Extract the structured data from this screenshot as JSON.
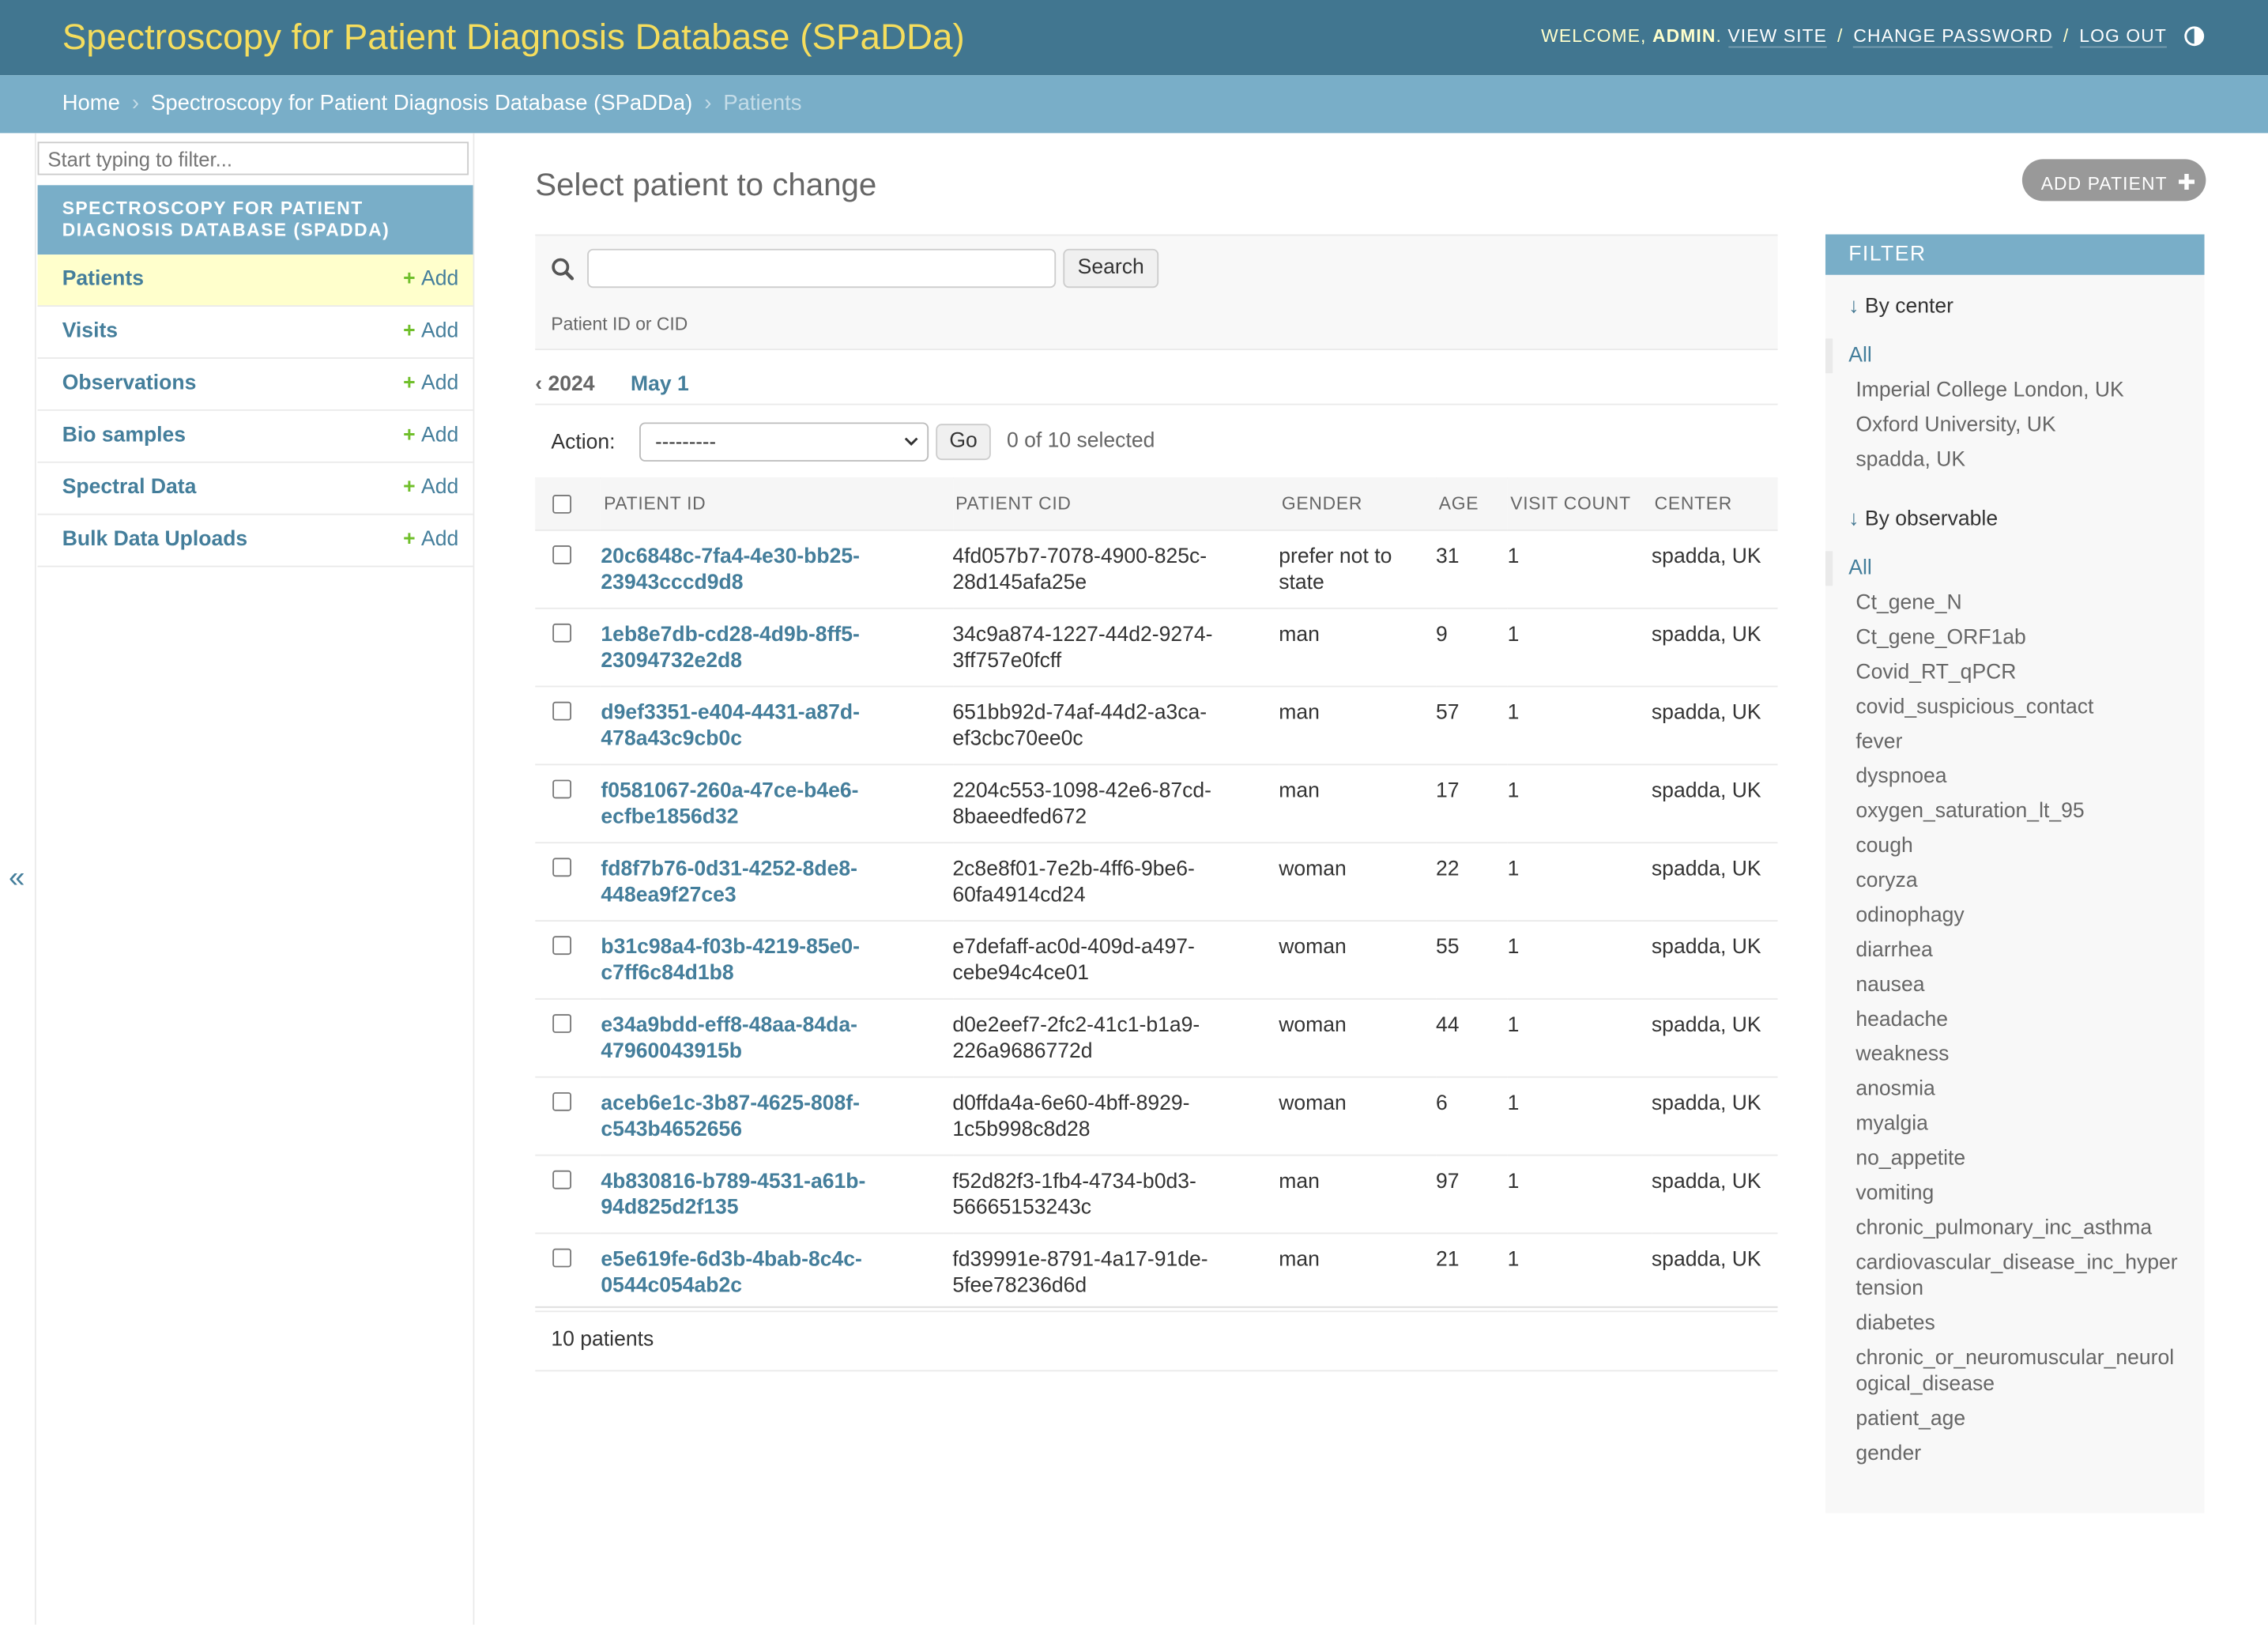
{
  "header": {
    "brand": "Spectroscopy for Patient Diagnosis Database (SPaDDa)",
    "welcome": "WELCOME,",
    "username": "ADMIN",
    "view_site": "VIEW SITE",
    "change_password": "CHANGE PASSWORD",
    "log_out": "LOG OUT",
    "separator": "/"
  },
  "breadcrumbs": {
    "home": "Home",
    "app": "Spectroscopy for Patient Diagnosis Database (SPaDDa)",
    "current": "Patients",
    "arrow": "›"
  },
  "sidebar": {
    "filter_placeholder": "Start typing to filter...",
    "app_caption": "Spectroscopy for Patient Diagnosis Database (SPaDDa)",
    "add_label": "Add",
    "items": [
      {
        "label": "Patients"
      },
      {
        "label": "Visits"
      },
      {
        "label": "Observations"
      },
      {
        "label": "Bio samples"
      },
      {
        "label": "Spectral Data"
      },
      {
        "label": "Bulk Data Uploads"
      }
    ],
    "collapse_glyph": "«"
  },
  "main": {
    "title": "Select patient to change",
    "add_button": "ADD PATIENT",
    "search_button": "Search",
    "search_help": "Patient ID or CID",
    "date_back": "‹ 2024",
    "date_day": "May 1",
    "action_label": "Action:",
    "action_selected": "---------",
    "go_button": "Go",
    "selected_counter": "0 of 10 selected",
    "columns": [
      "PATIENT ID",
      "PATIENT CID",
      "GENDER",
      "AGE",
      "VISIT COUNT",
      "CENTER"
    ],
    "rows": [
      {
        "id1": "20c6848c-7fa4-4e30-bb25-",
        "id2": "23943cccd9d8",
        "cid1": "4fd057b7-7078-4900-825c-",
        "cid2": "28d145afa25e",
        "g1": "prefer not to",
        "g2": "state",
        "age": "31",
        "visits": "1",
        "center": "spadda, UK"
      },
      {
        "id1": "1eb8e7db-cd28-4d9b-8ff5-",
        "id2": "23094732e2d8",
        "cid1": "34c9a874-1227-44d2-9274-",
        "cid2": "3ff757e0fcff",
        "g1": "man",
        "g2": "",
        "age": "9",
        "visits": "1",
        "center": "spadda, UK"
      },
      {
        "id1": "d9ef3351-e404-4431-a87d-",
        "id2": "478a43c9cb0c",
        "cid1": "651bb92d-74af-44d2-a3ca-",
        "cid2": "ef3cbc70ee0c",
        "g1": "man",
        "g2": "",
        "age": "57",
        "visits": "1",
        "center": "spadda, UK"
      },
      {
        "id1": "f0581067-260a-47ce-b4e6-",
        "id2": "ecfbe1856d32",
        "cid1": "2204c553-1098-42e6-87cd-",
        "cid2": "8baeedfed672",
        "g1": "man",
        "g2": "",
        "age": "17",
        "visits": "1",
        "center": "spadda, UK"
      },
      {
        "id1": "fd8f7b76-0d31-4252-8de8-",
        "id2": "448ea9f27ce3",
        "cid1": "2c8e8f01-7e2b-4ff6-9be6-",
        "cid2": "60fa4914cd24",
        "g1": "woman",
        "g2": "",
        "age": "22",
        "visits": "1",
        "center": "spadda, UK"
      },
      {
        "id1": "b31c98a4-f03b-4219-85e0-",
        "id2": "c7ff6c84d1b8",
        "cid1": "e7defaff-ac0d-409d-a497-",
        "cid2": "cebe94c4ce01",
        "g1": "woman",
        "g2": "",
        "age": "55",
        "visits": "1",
        "center": "spadda, UK"
      },
      {
        "id1": "e34a9bdd-eff8-48aa-84da-",
        "id2": "47960043915b",
        "cid1": "d0e2eef7-2fc2-41c1-b1a9-",
        "cid2": "226a9686772d",
        "g1": "woman",
        "g2": "",
        "age": "44",
        "visits": "1",
        "center": "spadda, UK"
      },
      {
        "id1": "aceb6e1c-3b87-4625-808f-",
        "id2": "c543b4652656",
        "cid1": "d0ffda4a-6e60-4bff-8929-",
        "cid2": "1c5b998c8d28",
        "g1": "woman",
        "g2": "",
        "age": "6",
        "visits": "1",
        "center": "spadda, UK"
      },
      {
        "id1": "4b830816-b789-4531-a61b-",
        "id2": "94d825d2f135",
        "cid1": "f52d82f3-1fb4-4734-b0d3-",
        "cid2": "56665153243c",
        "g1": "man",
        "g2": "",
        "age": "97",
        "visits": "1",
        "center": "spadda, UK"
      },
      {
        "id1": "e5e619fe-6d3b-4bab-8c4c-",
        "id2": "0544c054ab2c",
        "cid1": "fd39991e-8791-4a17-91de-",
        "cid2": "5fee78236d6d",
        "g1": "man",
        "g2": "",
        "age": "21",
        "visits": "1",
        "center": "spadda, UK"
      }
    ],
    "paginator": "10 patients"
  },
  "filter": {
    "title": "FILTER",
    "by_center": {
      "title": "By center",
      "options": [
        "All",
        "Imperial College London, UK",
        "Oxford University, UK",
        "spadda, UK"
      ]
    },
    "by_observable": {
      "title": "By observable",
      "options": [
        "All",
        "Ct_gene_N",
        "Ct_gene_ORF1ab",
        "Covid_RT_qPCR",
        "covid_suspicious_contact",
        "fever",
        "dyspnoea",
        "oxygen_saturation_lt_95",
        "cough",
        "coryza",
        "odinophagy",
        "diarrhea",
        "nausea",
        "headache",
        "weakness",
        "anosmia",
        "myalgia",
        "no_appetite",
        "vomiting",
        "chronic_pulmonary_inc_asthma",
        "cardiovascular_disease_inc_hypertension",
        "diabetes",
        "chronic_or_neuromuscular_neurological_disease",
        "patient_age",
        "gender"
      ]
    }
  },
  "colors": {
    "header_bg": "#417690",
    "brand": "#f5dd5d",
    "breadcrumb_bg": "#79aec8",
    "link": "#447e9b",
    "active_row": "#ffffcc",
    "add_plus": "#70bf2b"
  }
}
